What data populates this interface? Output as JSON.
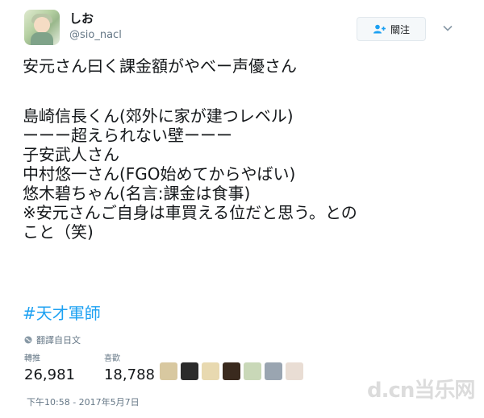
{
  "user": {
    "display_name": "しお",
    "handle": "@sio_nacl"
  },
  "follow_button": {
    "label": "關注",
    "icon": "add-user-icon"
  },
  "menu": {
    "icon": "chevron-down-icon"
  },
  "tweet": {
    "lines": [
      "安元さん曰く課金額がやべー声優さん",
      "島崎信長くん(郊外に家が建つレベル)",
      "ーーー超えられない壁ーーー",
      "子安武人さん",
      "中村悠一さん(FGO始めてからやばい)",
      "悠木碧ちゃん(名言:課金は食事)",
      "※安元さんご自身は車買える位だと思う。との",
      "こと（笑)"
    ],
    "hashtag": "#天才軍師"
  },
  "translate": {
    "label": "翻譯自日文",
    "icon": "globe-icon"
  },
  "stats": {
    "retweets_label": "轉推",
    "retweets_value": "26,981",
    "likes_label": "喜歡",
    "likes_value": "18,788"
  },
  "likers": [
    {
      "icon": "liker-avatar-1",
      "color": "#d8c8a0"
    },
    {
      "icon": "liker-avatar-2",
      "color": "#2b2b2b"
    },
    {
      "icon": "liker-avatar-3",
      "color": "#e8d9b0"
    },
    {
      "icon": "liker-avatar-4",
      "color": "#3a2a1e"
    },
    {
      "icon": "liker-avatar-5",
      "color": "#c9d8b8"
    },
    {
      "icon": "liker-avatar-6",
      "color": "#9aa5b1"
    },
    {
      "icon": "liker-avatar-7",
      "color": "#e9ddd4"
    }
  ],
  "timestamp": "下午10:58 - 2017年5月7日",
  "watermark": "d.cn当乐网",
  "colors": {
    "link": "#1da1f2",
    "secondary_text": "#657786"
  }
}
